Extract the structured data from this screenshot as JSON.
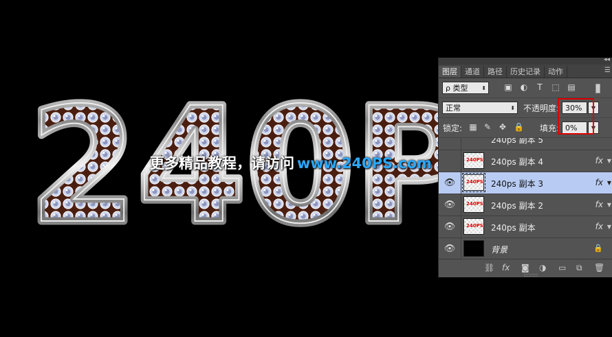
{
  "artwork": {
    "text": "240P",
    "watermark_cn": "更多精品教程，请访问",
    "watermark_url": "www.240PS.com",
    "watermark_url_color": "#2aa8ff",
    "fill_color": "#5a2a1a"
  },
  "panel": {
    "tabs": [
      "图层",
      "通道",
      "路径",
      "历史记录",
      "动作"
    ],
    "active_tab": "图层",
    "filter": {
      "search_glyph": "ρ",
      "label": "类型"
    },
    "blend_mode": "正常",
    "opacity_label": "不透明度:",
    "opacity_value": "30%",
    "lock_label": "锁定:",
    "fill_label": "填充:",
    "fill_value": "0%",
    "layers": [
      {
        "name": "240ps 副本 5",
        "visible": false,
        "fx": false,
        "partial": true
      },
      {
        "name": "240ps 副本 4",
        "visible": false,
        "fx": true,
        "thumb_text": "240PS"
      },
      {
        "name": "240ps 副本 3",
        "visible": true,
        "fx": true,
        "selected": true,
        "thumb_text": "240PS"
      },
      {
        "name": "240ps 副本 2",
        "visible": true,
        "fx": true,
        "thumb_text": "240PS"
      },
      {
        "name": "240ps 副本",
        "visible": true,
        "fx": true,
        "thumb_text": "240PS"
      },
      {
        "name": "背景",
        "visible": true,
        "fx": false,
        "locked": true
      }
    ],
    "highlight_color": "#e00000",
    "selected_color": "#b8cbf2"
  }
}
